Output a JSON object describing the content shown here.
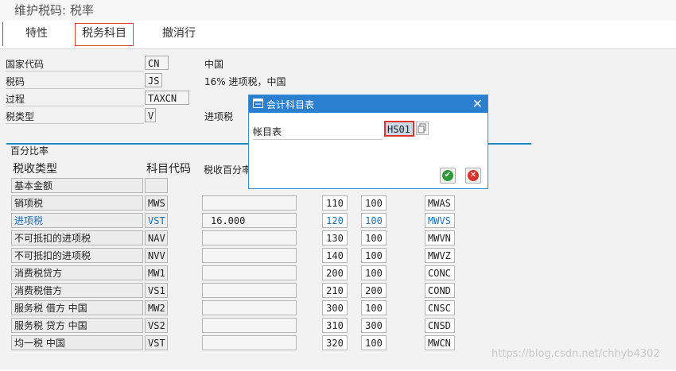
{
  "window": {
    "title": "维护税码: 税率"
  },
  "toolbar": {
    "items": [
      "特性",
      "税务科目",
      "撤消行"
    ]
  },
  "header_fields": {
    "country_label": "国家代码",
    "country_value": "CN",
    "country_desc": "中国",
    "taxcode_label": "税码",
    "taxcode_value": "JS",
    "taxcode_desc": "16% 进项税，中国",
    "procedure_label": "过程",
    "procedure_value": "TAXCN",
    "taxtype_label": "税类型",
    "taxtype_value": "V",
    "taxtype_desc": "进项税"
  },
  "percent_group": {
    "title": "百分比率",
    "col_taxtype": "税收类型",
    "col_account_key": "科目代码",
    "col_rate": "税收百分率",
    "rows": [
      {
        "type": "基本金额",
        "key": "",
        "rate": "",
        "level": "",
        "from": "",
        "cond": ""
      },
      {
        "type": "销项税",
        "key": "MWS",
        "rate": "",
        "level": "110",
        "from": "100",
        "cond": "MWAS"
      },
      {
        "type": "进项税",
        "key": "VST",
        "rate": "16.000",
        "level": "120",
        "from": "100",
        "cond": "MWVS"
      },
      {
        "type": "不可抵扣的进项税",
        "key": "NAV",
        "rate": "",
        "level": "130",
        "from": "100",
        "cond": "MWVN"
      },
      {
        "type": "不可抵扣的进项税",
        "key": "NVV",
        "rate": "",
        "level": "140",
        "from": "100",
        "cond": "MWVZ"
      },
      {
        "type": "消费税贷方",
        "key": "MW1",
        "rate": "",
        "level": "200",
        "from": "100",
        "cond": "CONC"
      },
      {
        "type": "消费税借方",
        "key": "VS1",
        "rate": "",
        "level": "210",
        "from": "200",
        "cond": "COND"
      },
      {
        "type": "服务税 借方 中国",
        "key": "MW2",
        "rate": "",
        "level": "300",
        "from": "100",
        "cond": "CNSC"
      },
      {
        "type": "服务税 贷方 中国",
        "key": "VS2",
        "rate": "",
        "level": "310",
        "from": "300",
        "cond": "CNSD"
      },
      {
        "type": "均一税 中国",
        "key": "VST",
        "rate": "",
        "level": "320",
        "from": "100",
        "cond": "MWCN"
      }
    ]
  },
  "dialog": {
    "title": "会计科目表",
    "field_label": "帐目表",
    "field_value": "HS01"
  },
  "colors": {
    "dialog_title_bg": "#2b7fd0",
    "group_line": "#1b8ac8",
    "highlight_text": "#1f6fb5",
    "active_tab_border": "#d9453a"
  },
  "icons": [
    "dialog-window-icon",
    "close-icon",
    "value-help-icon",
    "confirm-check-icon",
    "cancel-x-icon"
  ],
  "watermark": "https://blog.csdn.net/chhyb4302"
}
